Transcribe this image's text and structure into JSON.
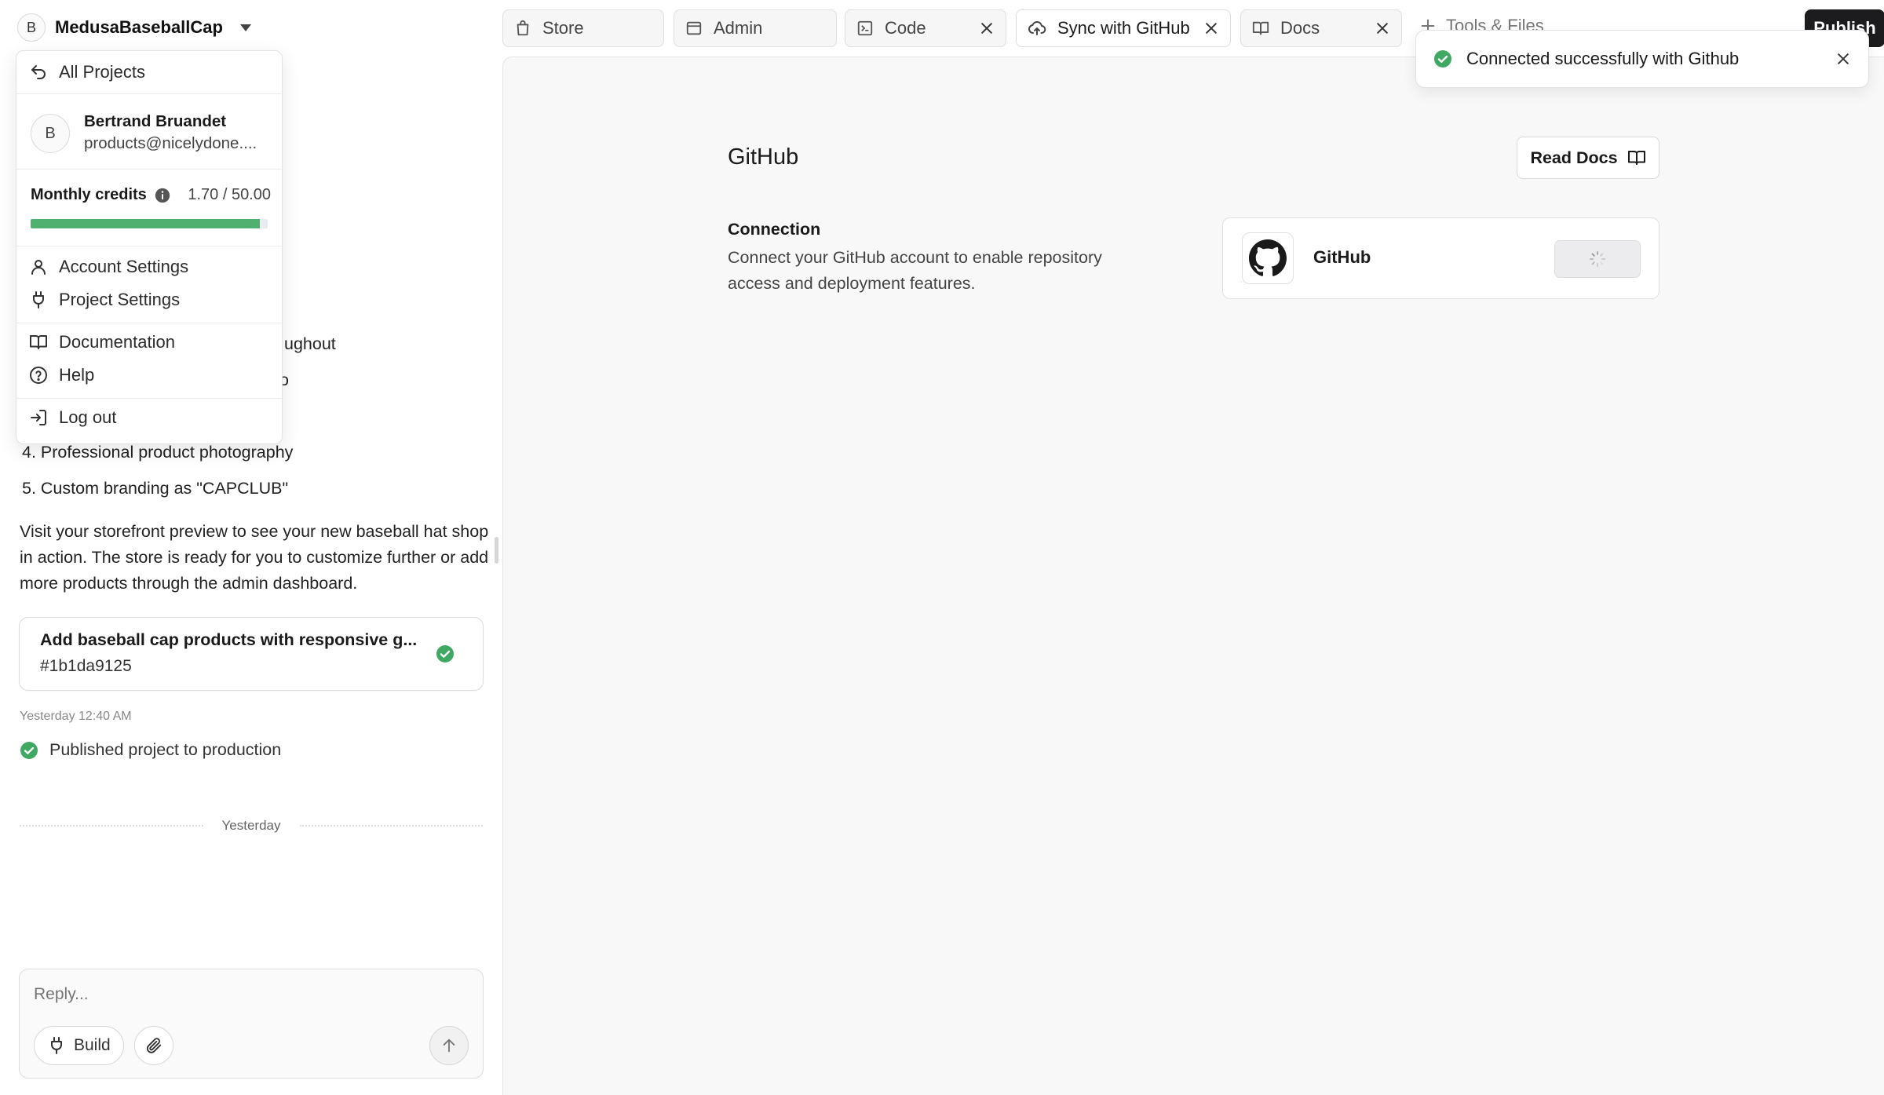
{
  "project": {
    "avatar_letter": "B",
    "name": "MedusaBaseballCap"
  },
  "menu": {
    "all_projects": "All Projects",
    "user": {
      "avatar_letter": "B",
      "name": "Bertrand Bruandet",
      "email": "products@nicelydone...."
    },
    "credits": {
      "label": "Monthly credits",
      "value": "1.70 / 50.00",
      "used_fraction": 0.966
    },
    "account_settings": "Account Settings",
    "project_settings": "Project Settings",
    "documentation": "Documentation",
    "help": "Help",
    "log_out": "Log out"
  },
  "chat": {
    "partial_line_1": "ughout",
    "partial_line_2": "o",
    "list": [
      "4. Professional product photography",
      "5. Custom branding as \"CAPCLUB\""
    ],
    "paragraph": "Visit your storefront preview to see your new baseball hat shop in action. The store is ready for you to customize further or add more products through the admin dashboard.",
    "commit": {
      "title": "Add baseball cap products with responsive g...",
      "hash": "#1b1da9125"
    },
    "timestamp": "Yesterday 12:40 AM",
    "published": "Published project to production",
    "divider": "Yesterday",
    "reply_placeholder": "Reply...",
    "build_label": "Build"
  },
  "tabs": {
    "store": "Store",
    "admin": "Admin",
    "code": "Code",
    "sync": "Sync with GitHub",
    "docs": "Docs",
    "tools": "Tools & Files",
    "publish": "Publish"
  },
  "toast": {
    "message": "Connected successfully with Github"
  },
  "github_page": {
    "title": "GitHub",
    "read_docs": "Read Docs",
    "connection_label": "Connection",
    "connection_desc": "Connect your GitHub account to enable repository access and deployment features.",
    "card_name": "GitHub"
  },
  "colors": {
    "success": "#3fa863",
    "publish_bg": "#1c1c1e",
    "progress": "#4fb06f"
  }
}
